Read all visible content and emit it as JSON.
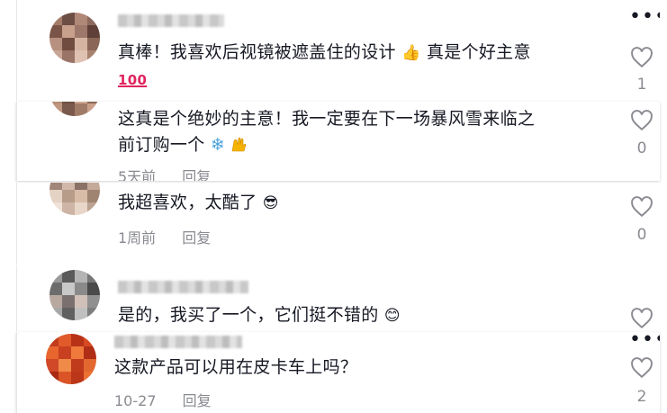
{
  "comments": [
    {
      "text": "真棒！我喜欢后视镜被遮盖住的设计",
      "text_suffix": "真是个好主意",
      "badge": "100",
      "likes": "1",
      "more": "•••"
    },
    {
      "text": "这真是个绝妙的主意！我一定要在下一场暴风雪来临之",
      "text_line2": "前订购一个",
      "snow": "❄",
      "time": "5天前",
      "reply": "回复",
      "likes": "0"
    },
    {
      "text": "我超喜欢，太酷了",
      "time": "1周前",
      "reply": "回复",
      "likes": "0"
    },
    {
      "text": "是的，我买了一个，它们挺不错的"
    },
    {
      "text": "这款产品可以用在皮卡车上吗？",
      "time": "10-27",
      "reply": "回复",
      "likes": "2",
      "more": "•••"
    }
  ],
  "icons": [
    "heart-outline-icon",
    "more-dots-icon",
    "thumbs-up-emoji",
    "sunglasses-emoji",
    "smile-emoji",
    "raised-hands-emoji",
    "snowflake-emoji"
  ],
  "colors": {
    "text": "#161823",
    "muted": "#8a8b91",
    "badge": "#e0245e"
  }
}
